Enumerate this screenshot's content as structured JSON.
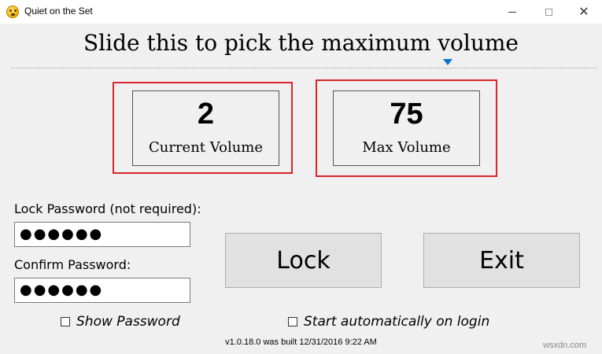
{
  "window": {
    "title": "Quiet on the Set",
    "icon": "smiley-face-icon",
    "controls": {
      "minimize_icon": "minimize-icon",
      "maximize_icon": "maximize-icon",
      "close_icon": "close-icon",
      "close_glyph": "✕"
    }
  },
  "heading": "Slide this to pick the maximum volume",
  "slider": {
    "value": 75,
    "thumb_color": "#0b73d1"
  },
  "current_volume": {
    "value": "2",
    "label": "Current Volume"
  },
  "max_volume": {
    "value": "75",
    "label": "Max Volume"
  },
  "highlight_color": "#d9252b",
  "lock_password": {
    "label": "Lock Password (not required):",
    "value": "●●●●●●"
  },
  "confirm_password": {
    "label": "Confirm Password:",
    "value": "●●●●●●"
  },
  "buttons": {
    "lock": "Lock",
    "exit": "Exit"
  },
  "checkboxes": {
    "show_password": "Show Password",
    "start_auto": "Start automatically on login"
  },
  "version": "v1.0.18.0 was built 12/31/2016 9:22 AM",
  "watermark": "wsxdn.com"
}
